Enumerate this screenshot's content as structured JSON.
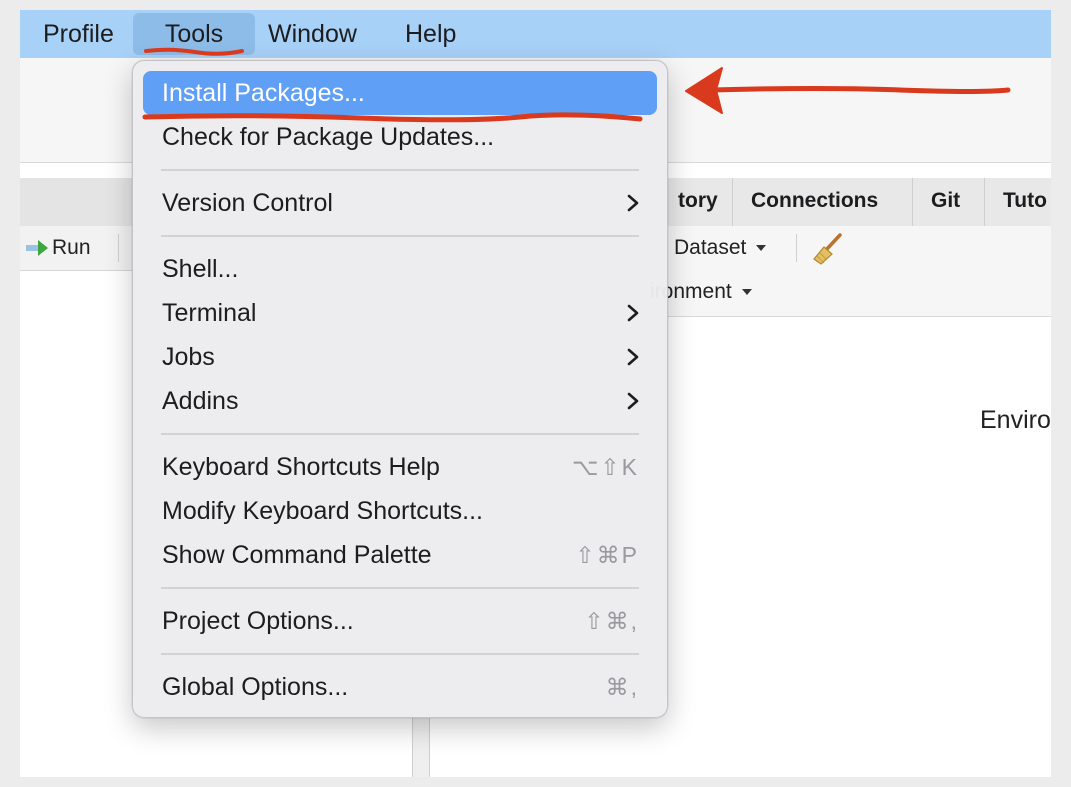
{
  "menubar": {
    "items": [
      {
        "label": "Profile"
      },
      {
        "label": "Tools"
      },
      {
        "label": "Window"
      },
      {
        "label": "Help"
      }
    ],
    "active_item": "Tools"
  },
  "ide": {
    "left_toolbar": {
      "run_label": "Run"
    },
    "right_tabs": [
      {
        "label": "tory"
      },
      {
        "label": "Connections"
      },
      {
        "label": "Git"
      },
      {
        "label": "Tuto"
      }
    ],
    "dataset_label": "Dataset",
    "environment_label": "ironment",
    "pane_message": "Enviro"
  },
  "tools_menu": {
    "highlighted_item": "Install Packages...",
    "items": [
      {
        "label": "Install Packages...",
        "shortcut": "",
        "submenu": false
      },
      {
        "label": "Check for Package Updates...",
        "shortcut": "",
        "submenu": false
      },
      {
        "label": "Version Control",
        "shortcut": "",
        "submenu": true
      },
      {
        "label": "Shell...",
        "shortcut": "",
        "submenu": false
      },
      {
        "label": "Terminal",
        "shortcut": "",
        "submenu": true
      },
      {
        "label": "Jobs",
        "shortcut": "",
        "submenu": true
      },
      {
        "label": "Addins",
        "shortcut": "",
        "submenu": true
      },
      {
        "label": "Keyboard Shortcuts Help",
        "shortcut": "⌥⇧K",
        "submenu": false
      },
      {
        "label": "Modify Keyboard Shortcuts...",
        "shortcut": "",
        "submenu": false
      },
      {
        "label": "Show Command Palette",
        "shortcut": "⇧⌘P",
        "submenu": false
      },
      {
        "label": "Project Options...",
        "shortcut": "⇧⌘,",
        "submenu": false
      },
      {
        "label": "Global Options...",
        "shortcut": "⌘,",
        "submenu": false
      }
    ]
  },
  "icons": {
    "run": "run-arrow-icon",
    "broom": "broom-icon",
    "submenu": "chevron-right-icon",
    "dropdown": "caret-down-icon"
  },
  "colors": {
    "menubar": "#a8d1f7",
    "highlight": "#5f9ff5",
    "annotation": "#d93a1e"
  }
}
